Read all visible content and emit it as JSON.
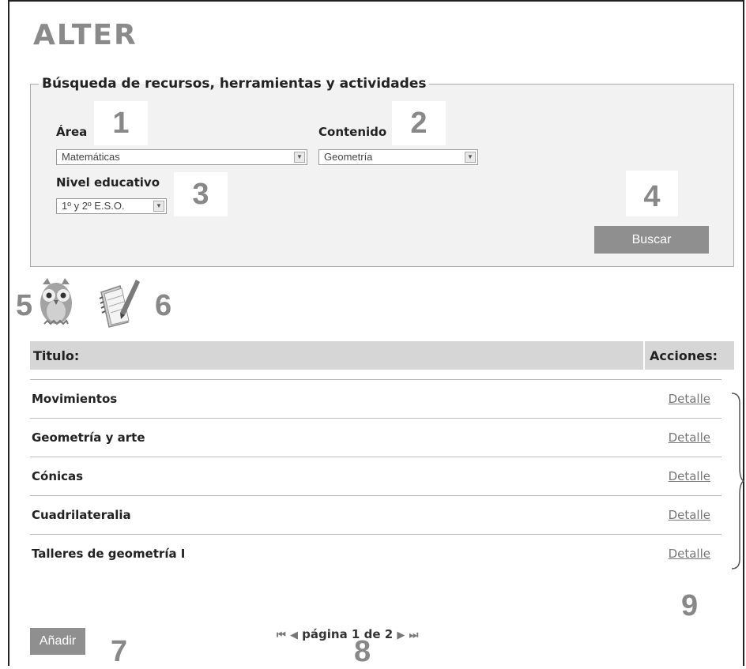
{
  "app": {
    "title": "ALTER"
  },
  "search": {
    "legend": "Búsqueda de recursos, herramientas y actividades",
    "area_label": "Área",
    "area_value": "Matemáticas",
    "contenido_label": "Contenido",
    "contenido_value": "Geometría",
    "nivel_label": "Nivel educativo",
    "nivel_value": "1º y 2º E.S.O.",
    "buscar_label": "Buscar"
  },
  "callouts": [
    "1",
    "2",
    "3",
    "4",
    "5",
    "6",
    "7",
    "8",
    "9"
  ],
  "icons": {
    "owl": "owl-icon",
    "notes": "notebook-pencil-icon"
  },
  "table": {
    "col_title": "Titulo:",
    "col_actions": "Acciones:",
    "rows": [
      {
        "title": "Movimientos",
        "action": "Detalle"
      },
      {
        "title": "Geometría y arte",
        "action": "Detalle"
      },
      {
        "title": "Cónicas",
        "action": "Detalle"
      },
      {
        "title": "Cuadrilateralia",
        "action": "Detalle"
      },
      {
        "title": "Talleres de geometría I",
        "action": "Detalle"
      }
    ]
  },
  "pager": {
    "text": "página 1 de 2"
  },
  "add_label": "Añadir"
}
